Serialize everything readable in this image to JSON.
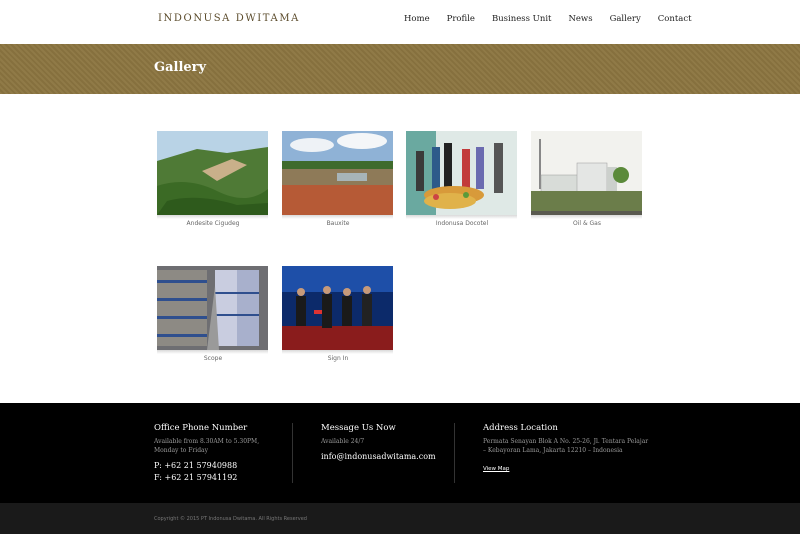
{
  "brand": {
    "logo": "INDONUSA DWITAMA"
  },
  "nav": [
    "Home",
    "Profile",
    "Business Unit",
    "News",
    "Gallery",
    "Contact"
  ],
  "page_title": "Gallery",
  "gallery": [
    {
      "caption": "Andesite Cigudeg"
    },
    {
      "caption": "Bauxite"
    },
    {
      "caption": "Indonusa Docotel"
    },
    {
      "caption": "Oil & Gas"
    },
    {
      "caption": "Scope"
    },
    {
      "caption": "Sign In"
    }
  ],
  "footer": {
    "phone": {
      "title": "Office Phone Number",
      "sub": "Available from 8.30AM to 5.30PM, Monday to Friday",
      "p": "P: +62 21 57940988",
      "f": "F: +62 21 57941192"
    },
    "message": {
      "title": "Message Us Now",
      "sub": "Available 24/7",
      "email": "info@indonusadwitama.com"
    },
    "address": {
      "title": "Address Location",
      "sub": "Permata Senayan Blok A No. 25-26, Jl. Tentara Pelajar – Kebayoran Lama, Jakarta 12210 – Indonesia",
      "link": "View Map"
    }
  },
  "copyright": "Copyright © 2015 PT Indonusa Dwitama. All Rights Reserved"
}
